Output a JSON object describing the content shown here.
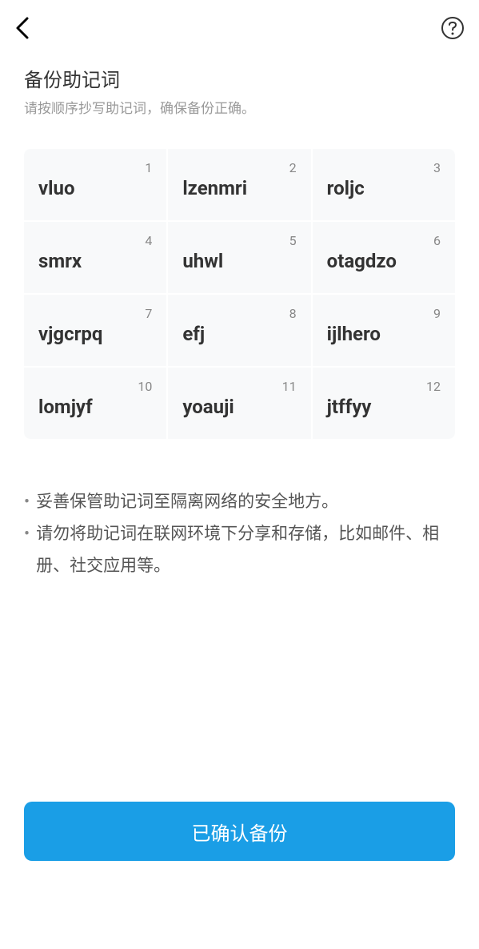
{
  "header": {
    "title": "备份助记词",
    "subtitle": "请按顺序抄写助记词，确保备份正确。"
  },
  "mnemonics": [
    {
      "index": "1",
      "word": "vluo"
    },
    {
      "index": "2",
      "word": "lzenmri"
    },
    {
      "index": "3",
      "word": "roljc"
    },
    {
      "index": "4",
      "word": "smrx"
    },
    {
      "index": "5",
      "word": "uhwl"
    },
    {
      "index": "6",
      "word": "otagdzo"
    },
    {
      "index": "7",
      "word": "vjgcrpq"
    },
    {
      "index": "8",
      "word": "efj"
    },
    {
      "index": "9",
      "word": "ijlhero"
    },
    {
      "index": "10",
      "word": "lomjyf"
    },
    {
      "index": "11",
      "word": "yoauji"
    },
    {
      "index": "12",
      "word": "jtffyy"
    }
  ],
  "tips": [
    "妥善保管助记词至隔离网络的安全地方。",
    "请勿将助记词在联网环境下分享和存储，比如邮件、相册、社交应用等。"
  ],
  "button": {
    "confirm_label": "已确认备份"
  }
}
